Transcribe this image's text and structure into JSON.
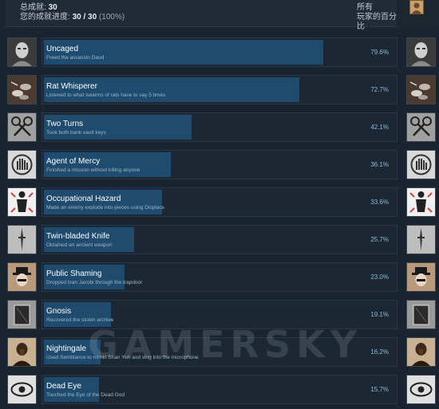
{
  "header": {
    "total_label": "总成就:",
    "total_value": "30",
    "progress_label": "您的成就进度:",
    "progress_value": "30 / 30",
    "progress_pct": "(100%)",
    "right_line1": "所有",
    "right_line2": "玩家的百分比"
  },
  "achievements": [
    {
      "title": "Uncaged",
      "desc": "Freed the assassin Daud",
      "pct": "79.6%",
      "rate": 79.6,
      "icon": "daud-face-icon"
    },
    {
      "title": "Rat Whisperer",
      "desc": "Listened to what swarms of rats have to say 5 times",
      "pct": "72.7%",
      "rate": 72.7,
      "icon": "rats-icon"
    },
    {
      "title": "Two Turns",
      "desc": "Took both bank vault keys",
      "pct": "42.1%",
      "rate": 42.1,
      "icon": "keys-icon"
    },
    {
      "title": "Agent of Mercy",
      "desc": "Finished a mission without killing anyone",
      "pct": "36.1%",
      "rate": 36.1,
      "icon": "mercy-hand-icon"
    },
    {
      "title": "Occupational Hazard",
      "desc": "Made an enemy explode into pieces using Displace",
      "pct": "33.6%",
      "rate": 33.6,
      "icon": "exploding-man-icon"
    },
    {
      "title": "Twin-bladed Knife",
      "desc": "Obtained an ancient weapon",
      "pct": "25.7%",
      "rate": 25.7,
      "icon": "knife-icon"
    },
    {
      "title": "Public Shaming",
      "desc": "Dropped Ivan Jacobi through the trapdoor",
      "pct": "23.0%",
      "rate": 23.0,
      "icon": "hat-man-icon"
    },
    {
      "title": "Gnosis",
      "desc": "Recovered the stolen archive",
      "pct": "19.1%",
      "rate": 19.1,
      "icon": "archive-book-icon"
    },
    {
      "title": "Nightingale",
      "desc": "Used Semblance to mimic Shan Yun and sing into the microphone",
      "pct": "16.2%",
      "rate": 16.2,
      "icon": "singer-icon"
    },
    {
      "title": "Dead Eye",
      "desc": "Touched the Eye of the Dead God",
      "pct": "15.7%",
      "rate": 15.7,
      "icon": "eye-icon"
    }
  ],
  "watermark": "GAMERSKY"
}
